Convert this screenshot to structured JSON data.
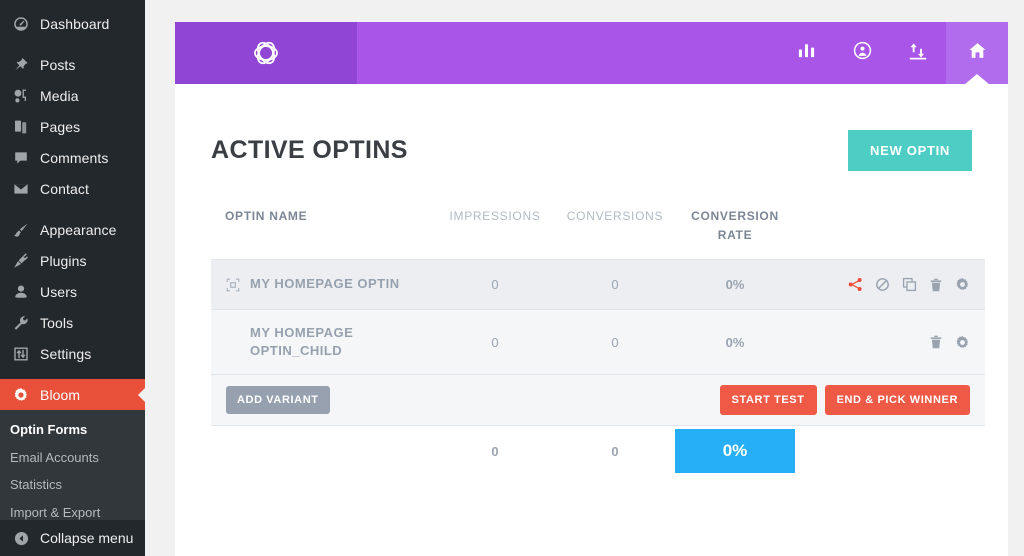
{
  "sidebar": {
    "primary_items": [
      {
        "label": "Dashboard",
        "icon": "dashboard-icon"
      },
      {
        "label": "Posts",
        "icon": "pin-icon"
      },
      {
        "label": "Media",
        "icon": "media-icon"
      },
      {
        "label": "Pages",
        "icon": "pages-icon"
      },
      {
        "label": "Comments",
        "icon": "comment-icon"
      },
      {
        "label": "Contact",
        "icon": "mail-icon"
      }
    ],
    "secondary_items": [
      {
        "label": "Appearance",
        "icon": "brush-icon"
      },
      {
        "label": "Plugins",
        "icon": "plug-icon"
      },
      {
        "label": "Users",
        "icon": "user-icon"
      },
      {
        "label": "Tools",
        "icon": "wrench-icon"
      },
      {
        "label": "Settings",
        "icon": "sliders-icon"
      }
    ],
    "current_item": {
      "label": "Bloom",
      "icon": "gear-icon"
    },
    "submenu_items": [
      {
        "label": "Optin Forms",
        "active": true
      },
      {
        "label": "Email Accounts",
        "active": false
      },
      {
        "label": "Statistics",
        "active": false
      },
      {
        "label": "Import & Export",
        "active": false
      }
    ],
    "collapse": {
      "label": "Collapse menu",
      "icon": "collapse-arrow-icon"
    }
  },
  "topbar": {
    "logo_name": "bloom-logo",
    "nav": [
      {
        "name": "statistics",
        "icon": "bar-chart-icon",
        "active": false
      },
      {
        "name": "account",
        "icon": "user-circle-icon",
        "active": false
      },
      {
        "name": "import-export",
        "icon": "import-export-icon",
        "active": false
      },
      {
        "name": "home",
        "icon": "home-icon",
        "active": true
      }
    ]
  },
  "page": {
    "title": "ACTIVE OPTINS",
    "new_optin_label": "NEW OPTIN"
  },
  "table": {
    "headers": {
      "name": "OPTIN NAME",
      "impressions": "IMPRESSIONS",
      "conversions": "CONVERSIONS",
      "rate_line1": "CONVERSION",
      "rate_line2": "RATE"
    },
    "rows": [
      {
        "name": "MY HOMEPAGE OPTIN",
        "impressions": "0",
        "conversions": "0",
        "rate": "0%",
        "leading_icon": "expand-target-icon",
        "actions": [
          "split-test-icon",
          "disable-icon",
          "duplicate-icon",
          "trash-icon",
          "gear-icon"
        ]
      },
      {
        "name": "MY HOMEPAGE OPTIN_CHILD",
        "impressions": "0",
        "conversions": "0",
        "rate": "0%",
        "leading_icon": null,
        "actions": [
          "trash-icon",
          "gear-icon"
        ]
      }
    ],
    "variant_row": {
      "add_variant_label": "ADD VARIANT",
      "start_test_label": "START TEST",
      "end_pick_winner_label": "END & PICK WINNER"
    },
    "totals": {
      "impressions": "0",
      "conversions": "0",
      "rate": "0%"
    }
  },
  "colors": {
    "brand_purple_dark": "#9045d4",
    "brand_purple": "#a855e8",
    "brand_purple_light": "#b06ced",
    "teal_button": "#4ecdc4",
    "red_button": "#ef5a47",
    "red_menu": "#e8503a",
    "blue_rate": "#26aff4",
    "rate_text": "#35b8f2",
    "sidebar_bg": "#23282d",
    "submenu_bg": "#32373c"
  }
}
